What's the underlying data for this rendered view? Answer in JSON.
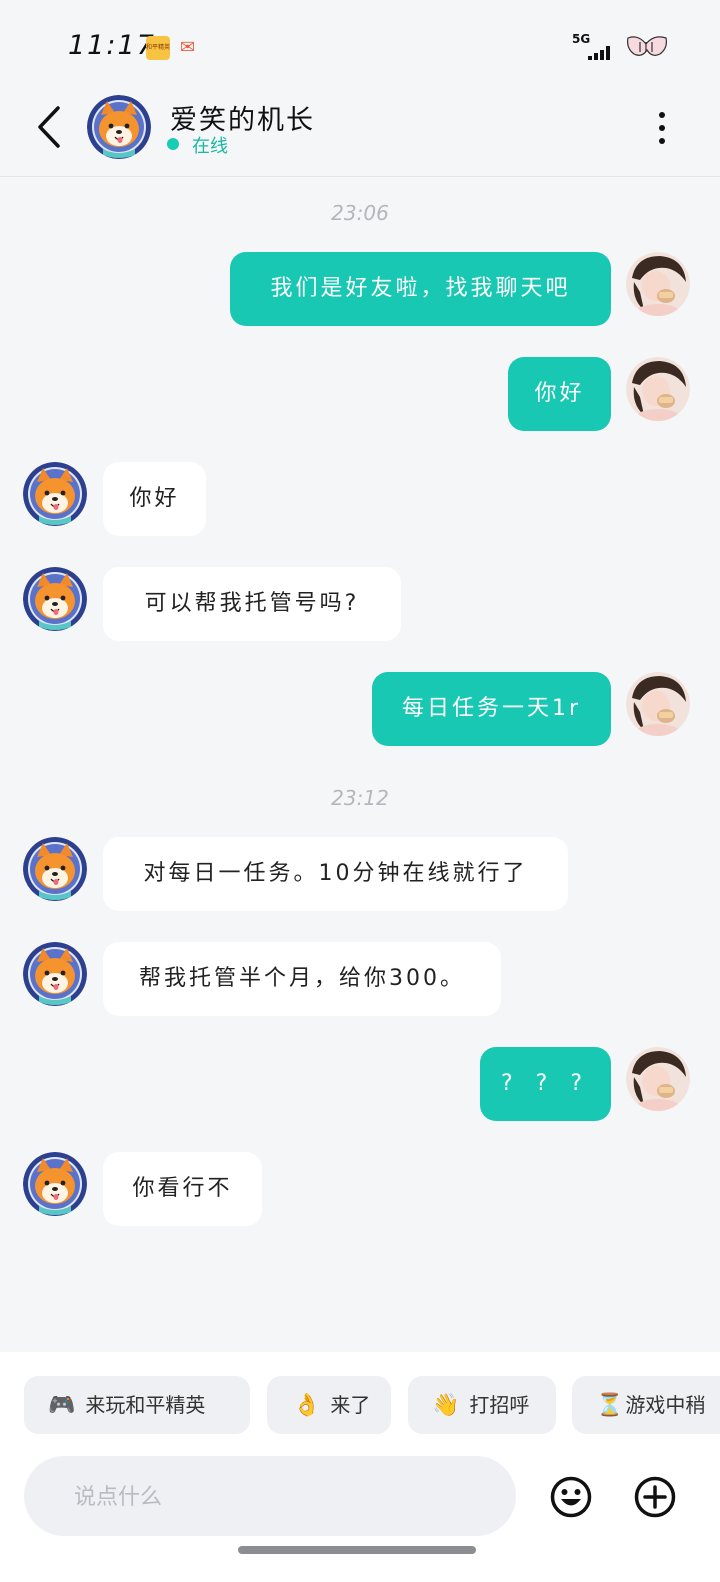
{
  "status_bar": {
    "time": "11:17",
    "network": "5G",
    "app_icon_1_text": "和平精英"
  },
  "header": {
    "contact_name": "爱笑的机长",
    "status": "在线"
  },
  "chat": {
    "time_labels": [
      "23:06",
      "23:12"
    ],
    "messages": [
      {
        "side": "out",
        "text": "我们是好友啦，找我聊天吧"
      },
      {
        "side": "out",
        "text": "你好"
      },
      {
        "side": "in",
        "text": "你好"
      },
      {
        "side": "in",
        "text": "可以帮我托管号吗?"
      },
      {
        "side": "out",
        "text": "每日任务一天1r"
      },
      {
        "side": "in",
        "text": "对每日一任务。10分钟在线就行了"
      },
      {
        "side": "in",
        "text": "帮我托管半个月，给你300。"
      },
      {
        "side": "out",
        "text": "? ? ?"
      },
      {
        "side": "in",
        "text": "你看行不"
      }
    ]
  },
  "quick_replies": [
    {
      "icon": "🎮",
      "icon_name": "gamepad-icon",
      "label": "来玩和平精英"
    },
    {
      "icon": "👌",
      "icon_name": "ok-hand-icon",
      "label": "来了"
    },
    {
      "icon": "👋",
      "icon_name": "wave-hand-icon",
      "label": "打招呼"
    },
    {
      "icon": "⏳",
      "icon_name": "hourglass-icon",
      "label": "游戏中稍"
    }
  ],
  "input": {
    "placeholder": "说点什么",
    "value": ""
  },
  "colors": {
    "accent": "#18c8b2",
    "online": "#18cdb3",
    "background": "#f5f6f8"
  }
}
